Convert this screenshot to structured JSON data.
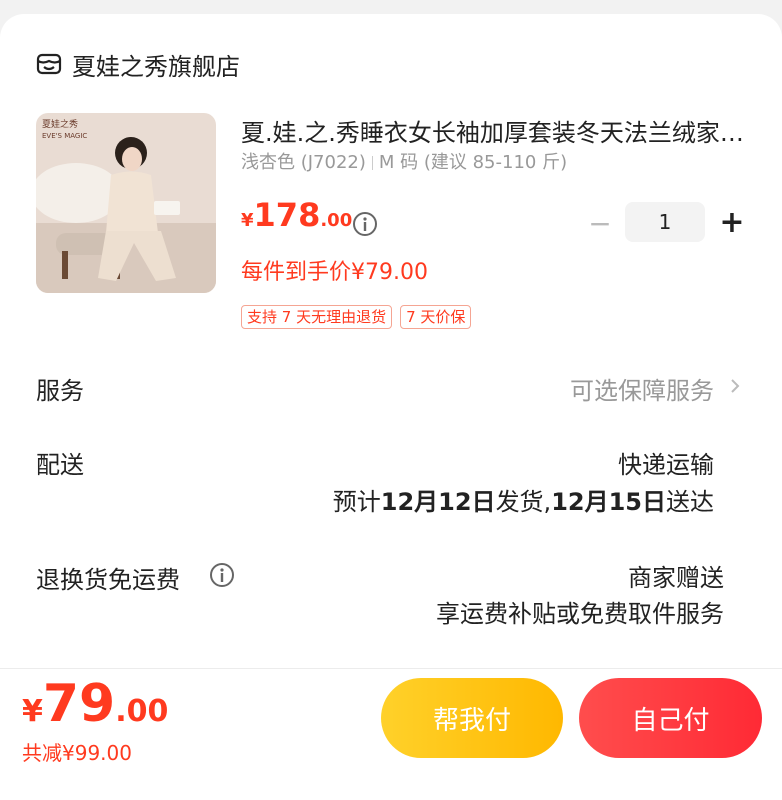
{
  "store": {
    "name": "夏娃之秀旗舰店",
    "icon": "store-icon"
  },
  "product": {
    "title": "夏.娃.之.秀睡衣女长袖加厚套装冬天法兰绒家居服",
    "spec": {
      "color": "浅杏色 (J7022)",
      "size": "M 码 (建议 85-110 斤)"
    },
    "price": {
      "currency": "¥",
      "integer": "178",
      "decimal": ".00"
    },
    "unit_price": "每件到手价¥79.00",
    "tags": [
      "支持 7 天无理由退货",
      "7 天价保"
    ],
    "quantity": "1",
    "thumb_brand_cn": "夏娃之秀",
    "thumb_brand_en": "EVE'S MAGIC"
  },
  "service": {
    "label": "服务",
    "value": "可选保障服务"
  },
  "delivery": {
    "label": "配送",
    "method": "快递运输",
    "estimate": {
      "p1": "预计",
      "ship_date": "12月12日",
      "p2": "发货,",
      "arrive_date": "12月15日",
      "p3": "送达"
    }
  },
  "return_shipping": {
    "label": "退换货免运费",
    "value": "商家赠送",
    "detail": "享运费补贴或免费取件服务"
  },
  "footer": {
    "total": {
      "currency": "¥",
      "integer": "79",
      "decimal": ".00"
    },
    "discount": "共减¥99.00",
    "help_pay": "帮我付",
    "self_pay": "自己付"
  },
  "colors": {
    "accent": "#ff3a1f",
    "help_btn": "#ffc21a",
    "pay_btn": "#ff3b3b"
  }
}
